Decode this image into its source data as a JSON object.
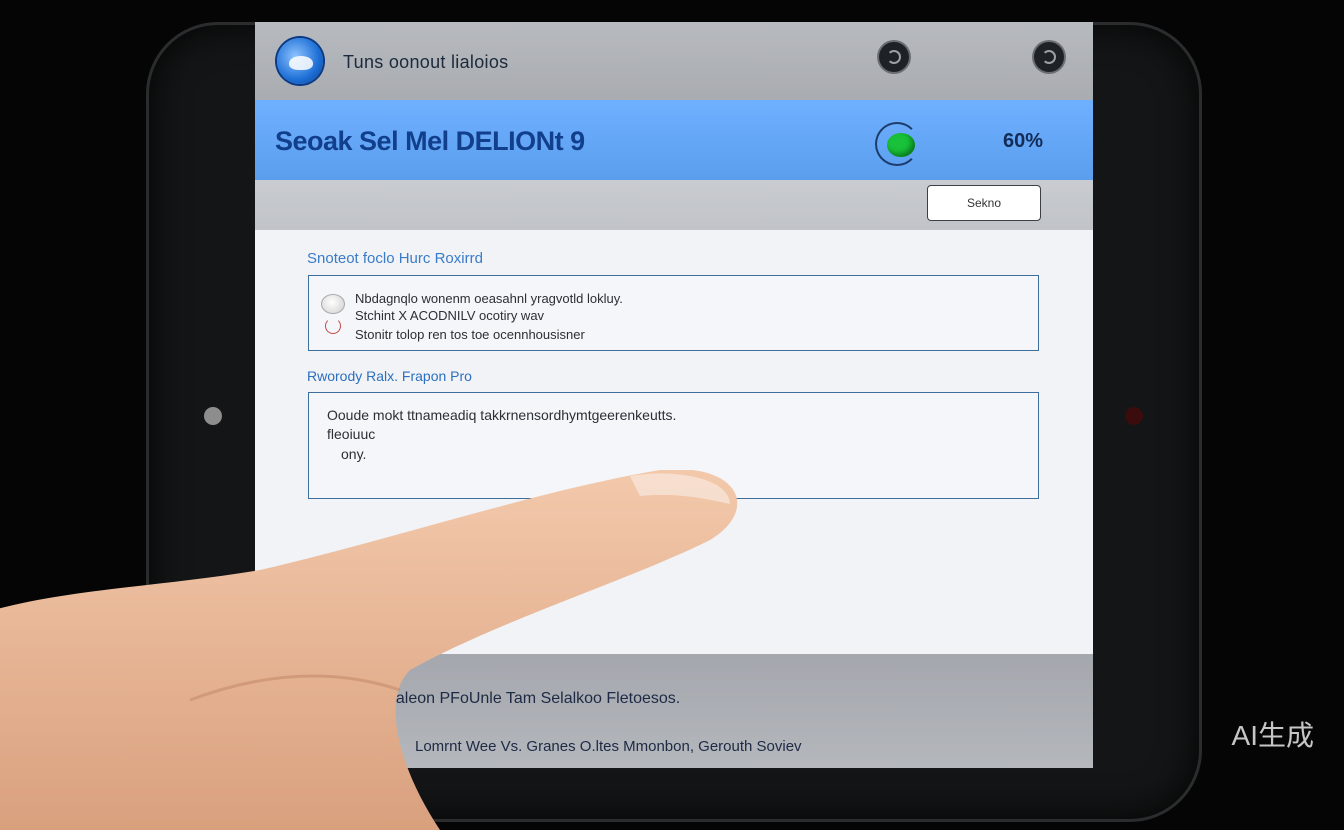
{
  "topbar": {
    "title": "Tuns oonout lialoios",
    "icons": [
      "app-logo",
      "settings-icon",
      "sync-icon"
    ]
  },
  "header": {
    "title": "Seoak Sel Mel DELIONt 9",
    "status_color": "#19c23a",
    "percent": "60%"
  },
  "subbar": {
    "button_label": "Sekno"
  },
  "sections": {
    "first_label": "Snoteot foclo Hurc Roxirrd",
    "first_lines": [
      "Nbdagnqlo wonenm oeasahnl yragvotld lokluy.",
      "Stchint X ACODNILV ocotiry wav",
      "Stonitr tolop ren tos toe ocennhousisner"
    ],
    "second_label": "Rworody Ralx. Frapon Pro",
    "second_lines": [
      "Ooude mokt ttnameadiq takkrnensordhymtgeerenkeutts.",
      "fleoiuuc",
      "ony."
    ]
  },
  "bottom": {
    "line1": "aaleon PFoUnle Tam Selalkoo Fletoesos.",
    "line2": "Lomrnt Wee Vs. Granes O.ltes Mmonbon, Gerouth Soviev"
  },
  "watermark": "AI生成",
  "colors": {
    "header_blue": "#6fb0ff",
    "accent": "#3a7cc8"
  }
}
